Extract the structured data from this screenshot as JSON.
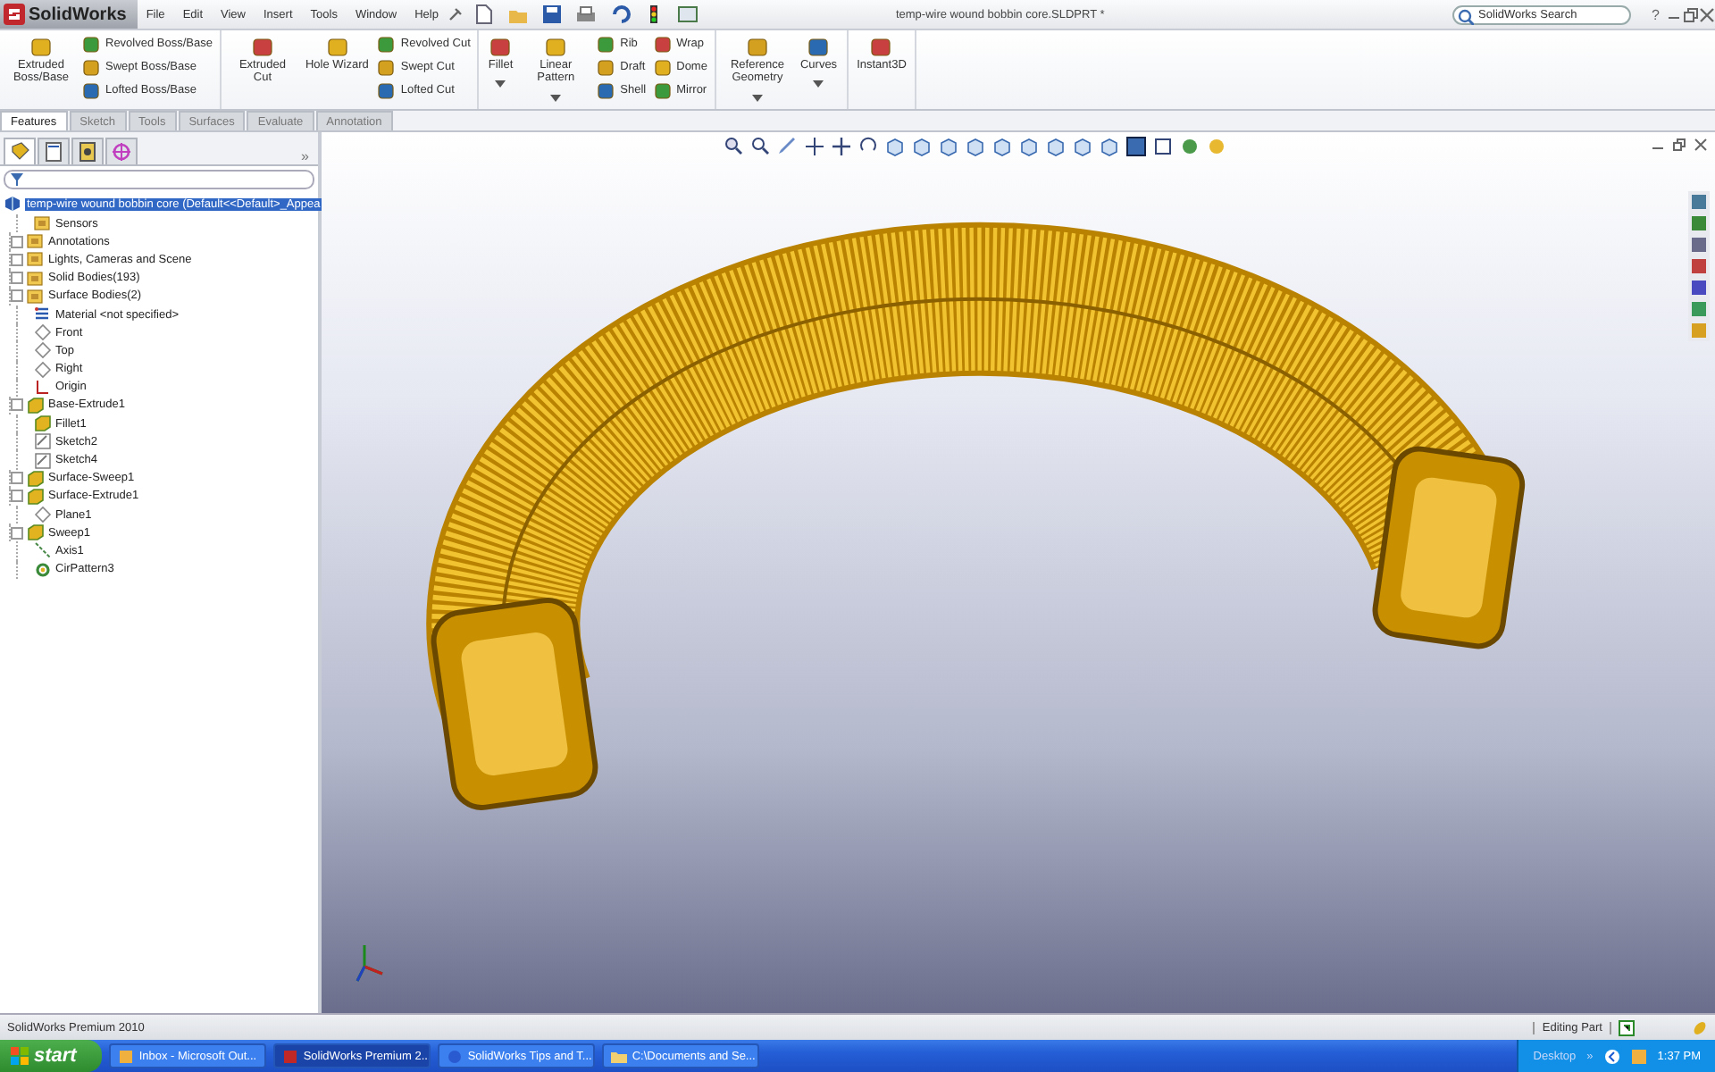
{
  "app": {
    "logo": "SolidWorks",
    "menus": [
      "File",
      "Edit",
      "View",
      "Insert",
      "Tools",
      "Window",
      "Help"
    ],
    "document_title": "temp-wire wound bobbin core.SLDPRT *",
    "search": {
      "placeholder": "SolidWorks Search"
    },
    "help": "?"
  },
  "ribbon": {
    "groups": [
      {
        "items": [
          {
            "kind": "large",
            "label": "Extruded Boss/Base",
            "dropdown": false
          },
          {
            "kind": "column",
            "labels": [
              "Revolved Boss/Base",
              "Swept Boss/Base",
              "Lofted Boss/Base"
            ]
          }
        ]
      },
      {
        "items": [
          {
            "kind": "large",
            "label": "Extruded Cut",
            "dropdown": false
          },
          {
            "kind": "large",
            "label": "Hole Wizard",
            "dropdown": false
          },
          {
            "kind": "column",
            "labels": [
              "Revolved Cut",
              "Swept Cut",
              "Lofted Cut"
            ]
          }
        ]
      },
      {
        "items": [
          {
            "kind": "large",
            "label": "Fillet",
            "dropdown": true
          },
          {
            "kind": "large",
            "label": "Linear Pattern",
            "dropdown": true
          },
          {
            "kind": "column",
            "labels": [
              "Rib",
              "Draft",
              "Shell"
            ]
          },
          {
            "kind": "column",
            "labels": [
              "Wrap",
              "Dome",
              "Mirror"
            ]
          }
        ]
      },
      {
        "items": [
          {
            "kind": "large",
            "label": "Reference Geometry",
            "dropdown": true
          },
          {
            "kind": "large",
            "label": "Curves",
            "dropdown": true
          }
        ]
      },
      {
        "items": [
          {
            "kind": "large",
            "label": "Instant3D",
            "dropdown": false
          }
        ]
      }
    ]
  },
  "command_tabs": [
    {
      "label": "Features",
      "selected": true
    },
    {
      "label": "Sketch",
      "selected": false
    },
    {
      "label": "Tools",
      "selected": false
    },
    {
      "label": "Surfaces",
      "selected": false
    },
    {
      "label": "Evaluate",
      "selected": false
    },
    {
      "label": "Annotation",
      "selected": false
    }
  ],
  "feature_tree": {
    "panel_tabs": [
      {
        "kind": "tree",
        "selected": true
      },
      {
        "kind": "property",
        "selected": false
      },
      {
        "kind": "config",
        "selected": false
      },
      {
        "kind": "display",
        "selected": false
      }
    ],
    "more": "»",
    "root": {
      "label": "temp-wire wound bobbin core  (Default<<Default>_Appea",
      "selected": true,
      "children": [
        {
          "label": "Sensors",
          "kind": "folder",
          "expandable": false
        },
        {
          "label": "Annotations",
          "kind": "folder",
          "expandable": true
        },
        {
          "label": "Lights, Cameras and Scene",
          "kind": "folder",
          "expandable": true
        },
        {
          "label": "Solid Bodies(193)",
          "kind": "folder",
          "expandable": true
        },
        {
          "label": "Surface Bodies(2)",
          "kind": "folder",
          "expandable": true
        },
        {
          "label": "Material <not specified>",
          "kind": "material",
          "expandable": false
        },
        {
          "label": "Front",
          "kind": "plane",
          "expandable": false
        },
        {
          "label": "Top",
          "kind": "plane",
          "expandable": false
        },
        {
          "label": "Right",
          "kind": "plane",
          "expandable": false
        },
        {
          "label": "Origin",
          "kind": "origin",
          "expandable": false
        },
        {
          "label": "Base-Extrude1",
          "kind": "feature",
          "expandable": true
        },
        {
          "label": "Fillet1",
          "kind": "feature",
          "expandable": false
        },
        {
          "label": "Sketch2",
          "kind": "sketch",
          "expandable": false
        },
        {
          "label": "Sketch4",
          "kind": "sketch",
          "expandable": false
        },
        {
          "label": "Surface-Sweep1",
          "kind": "feature",
          "expandable": true
        },
        {
          "label": "Surface-Extrude1",
          "kind": "feature",
          "expandable": true
        },
        {
          "label": "Plane1",
          "kind": "plane",
          "expandable": false
        },
        {
          "label": "Sweep1",
          "kind": "feature",
          "expandable": true
        },
        {
          "label": "Axis1",
          "kind": "axis",
          "expandable": false
        },
        {
          "label": "CirPattern3",
          "kind": "pattern",
          "expandable": false
        }
      ]
    }
  },
  "status_bar": {
    "product": "SolidWorks Premium 2010",
    "mode": "Editing Part"
  },
  "taskbar": {
    "start": "start",
    "tasks": [
      {
        "label": "Inbox - Microsoft Out...",
        "selected": false
      },
      {
        "label": "SolidWorks Premium 2...",
        "selected": true
      },
      {
        "label": "SolidWorks Tips and T...",
        "selected": false
      },
      {
        "label": "C:\\Documents and Se...",
        "selected": false
      }
    ],
    "tray_label": "Desktop",
    "chevron": "»",
    "clock": "1:37 PM"
  }
}
